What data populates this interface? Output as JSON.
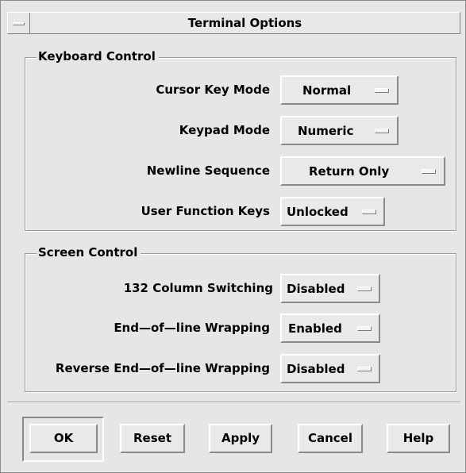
{
  "window": {
    "title": "Terminal Options",
    "menu_icon": "window-menu-icon"
  },
  "keyboard_control": {
    "title": "Keyboard Control",
    "rows": [
      {
        "label": "Cursor Key Mode",
        "value": "Normal"
      },
      {
        "label": "Keypad Mode",
        "value": "Numeric"
      },
      {
        "label": "Newline Sequence",
        "value": "Return Only"
      },
      {
        "label": "User Function Keys",
        "value": "Unlocked"
      }
    ]
  },
  "screen_control": {
    "title": "Screen Control",
    "rows": [
      {
        "label": "132 Column Switching",
        "value": "Disabled"
      },
      {
        "label": "End—of—line Wrapping",
        "value": "Enabled"
      },
      {
        "label": "Reverse End—of—line Wrapping",
        "value": "Disabled"
      }
    ]
  },
  "buttons": {
    "ok": "OK",
    "reset": "Reset",
    "apply": "Apply",
    "cancel": "Cancel",
    "help": "Help"
  },
  "colors": {
    "background": "#e6e6e6",
    "shadow": "#8a8a8a",
    "highlight": "#ffffff"
  }
}
